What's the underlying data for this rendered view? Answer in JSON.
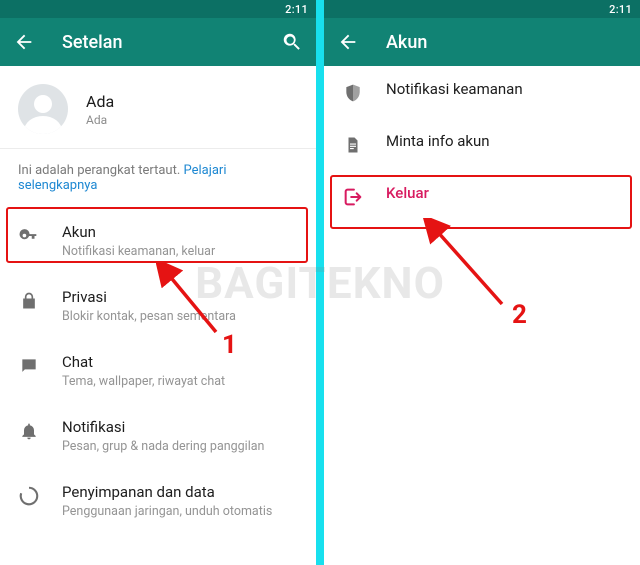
{
  "status_time": "2:11",
  "watermark_text": "BAGITEKNO",
  "left": {
    "appbar_title": "Setelan",
    "profile": {
      "name": "Ada",
      "sub": "Ada"
    },
    "linked_text": "Ini adalah perangkat tertaut. ",
    "linked_link": "Pelajari selengkapnya",
    "items": [
      {
        "title": "Akun",
        "sub": "Notifikasi keamanan, keluar"
      },
      {
        "title": "Privasi",
        "sub": "Blokir kontak, pesan sementara"
      },
      {
        "title": "Chat",
        "sub": "Tema, wallpaper, riwayat chat"
      },
      {
        "title": "Notifikasi",
        "sub": "Pesan, grup & nada dering panggilan"
      },
      {
        "title": "Penyimpanan dan data",
        "sub": "Penggunaan jaringan, unduh otomatis"
      }
    ],
    "step_label": "1"
  },
  "right": {
    "appbar_title": "Akun",
    "items": [
      {
        "title": "Notifikasi keamanan"
      },
      {
        "title": "Minta info akun"
      },
      {
        "title": "Keluar"
      }
    ],
    "step_label": "2"
  }
}
